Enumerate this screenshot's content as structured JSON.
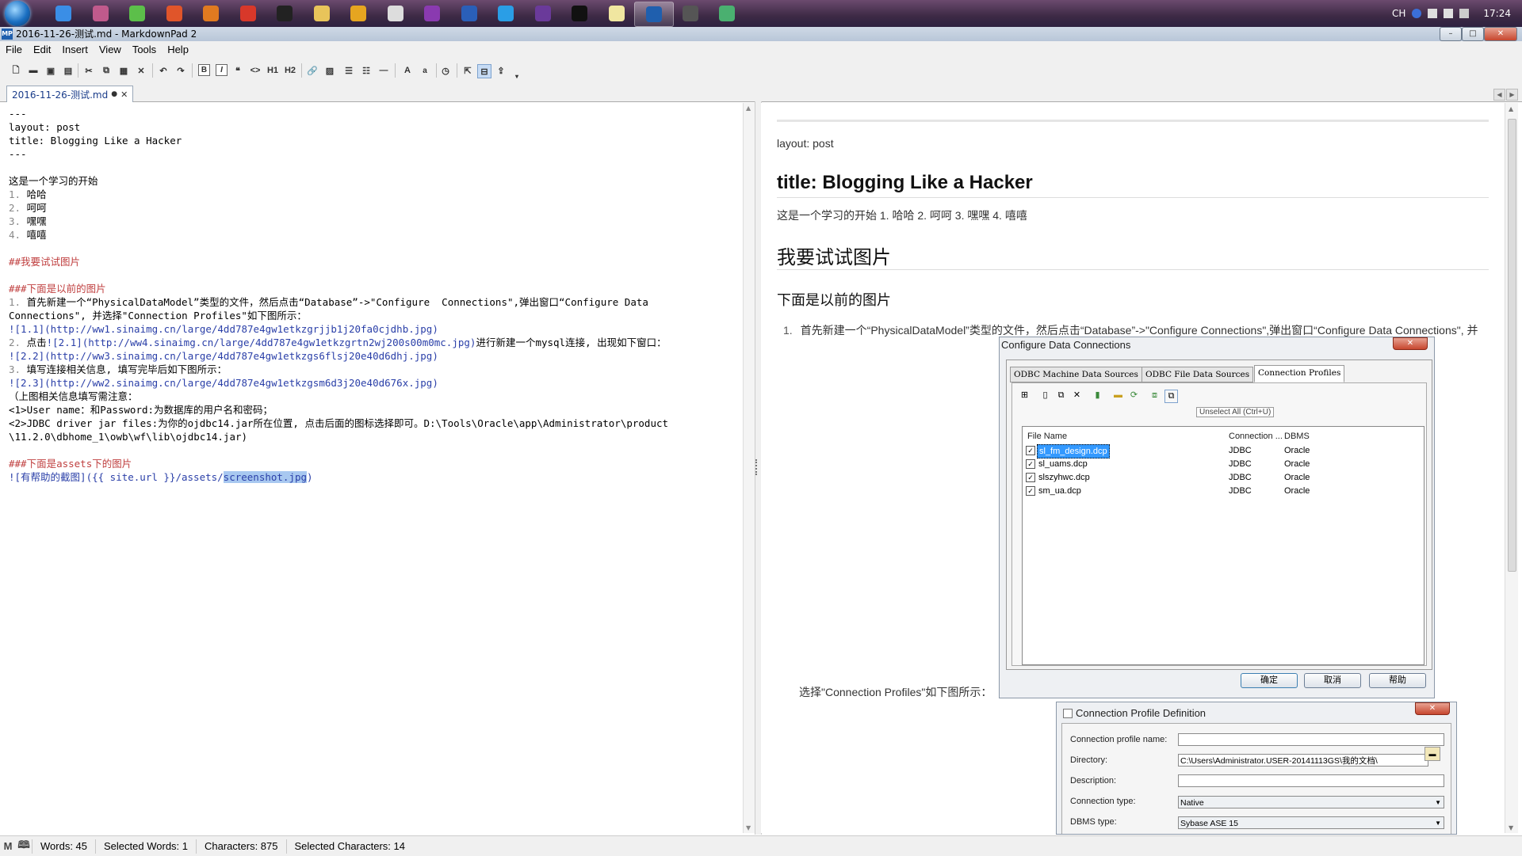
{
  "taskbar": {
    "apps": [
      {
        "name": "ie-icon",
        "color": "#3a8ee6"
      },
      {
        "name": "flower-app-icon",
        "color": "#c05a8c"
      },
      {
        "name": "green-app-icon",
        "color": "#5cbf4a"
      },
      {
        "name": "h-app-icon",
        "color": "#e0552a"
      },
      {
        "name": "firefox-icon",
        "color": "#e07a20"
      },
      {
        "name": "weibo-icon",
        "color": "#d8382a"
      },
      {
        "name": "chrome-dark-icon",
        "color": "#222222"
      },
      {
        "name": "folder-icon",
        "color": "#e8c45a"
      },
      {
        "name": "chrome-icon",
        "color": "#e6a520"
      },
      {
        "name": "circle-app-icon",
        "color": "#dddddd"
      },
      {
        "name": "onenote-icon",
        "color": "#8a3ab0"
      },
      {
        "name": "task-app-icon",
        "color": "#2a5fb8"
      },
      {
        "name": "qq-browser-icon",
        "color": "#2a9ee6"
      },
      {
        "name": "n-app-icon",
        "color": "#6a3a9a"
      },
      {
        "name": "cmd-icon",
        "color": "#111111"
      },
      {
        "name": "notepad-icon",
        "color": "#f0e6a0"
      },
      {
        "name": "markdownpad-icon",
        "color": "#1f5fae"
      },
      {
        "name": "m-app-icon",
        "color": "#555555"
      },
      {
        "name": "m-green-app-icon",
        "color": "#4ab070"
      }
    ],
    "tray": {
      "lang": "CH",
      "time": "17:24"
    }
  },
  "window": {
    "app_icon_text": "MP",
    "title": "2016-11-26-测试.md - MarkdownPad 2",
    "min": "–",
    "max": "□",
    "close": "✕"
  },
  "menu": [
    "File",
    "Edit",
    "Insert",
    "View",
    "Tools",
    "Help"
  ],
  "toolbar": {
    "h1": "H1",
    "h2": "H2",
    "bold": "B",
    "italic": "I",
    "font_big": "A",
    "font_small": "a"
  },
  "tab": {
    "label": "2016-11-26-测试.md",
    "modified": "●",
    "close": "✕"
  },
  "editor": {
    "lines": [
      [
        {
          "t": "---"
        }
      ],
      [
        {
          "t": "layout: post"
        }
      ],
      [
        {
          "t": "title: Blogging Like a Hacker"
        }
      ],
      [
        {
          "t": "---"
        }
      ],
      [
        {
          "t": ""
        }
      ],
      [
        {
          "t": "这是一个学习的开始"
        }
      ],
      [
        {
          "t": "1. ",
          "c": "c-num"
        },
        {
          "t": "哈哈"
        }
      ],
      [
        {
          "t": "2. ",
          "c": "c-num"
        },
        {
          "t": "呵呵"
        }
      ],
      [
        {
          "t": "3. ",
          "c": "c-num"
        },
        {
          "t": "嘿嘿"
        }
      ],
      [
        {
          "t": "4. ",
          "c": "c-num"
        },
        {
          "t": "嘻嘻"
        }
      ],
      [
        {
          "t": ""
        }
      ],
      [
        {
          "t": "##我要试试图片",
          "c": "c-head"
        }
      ],
      [
        {
          "t": ""
        }
      ],
      [
        {
          "t": "###下面是以前的图片",
          "c": "c-head"
        }
      ],
      [
        {
          "t": "1. ",
          "c": "c-num"
        },
        {
          "t": "首先新建一个“PhysicalDataModel”类型的文件，然后点击“Database”->\"Configure  Connections\",弹出窗口“Configure Data"
        }
      ],
      [
        {
          "t": "Connections\", 并选择\"Connection Profiles\"如下图所示："
        }
      ],
      [
        {
          "t": "![1.1](http://ww1.sinaimg.cn/large/4dd787e4gw1etkzgrjjb1j20fa0cjdhb.jpg)",
          "c": "c-link"
        }
      ],
      [
        {
          "t": "2. ",
          "c": "c-num"
        },
        {
          "t": "点击"
        },
        {
          "t": "![2.1](http://ww4.sinaimg.cn/large/4dd787e4gw1etkzgrtn2wj200s00m0mc.jpg)",
          "c": "c-link"
        },
        {
          "t": "进行新建一个mysql连接, 出现如下窗口："
        }
      ],
      [
        {
          "t": "![2.2](http://ww3.sinaimg.cn/large/4dd787e4gw1etkzgs6flsj20e40d6dhj.jpg)",
          "c": "c-link"
        }
      ],
      [
        {
          "t": "3. ",
          "c": "c-num"
        },
        {
          "t": "填写连接相关信息, 填写完毕后如下图所示："
        }
      ],
      [
        {
          "t": "![2.3](http://ww2.sinaimg.cn/large/4dd787e4gw1etkzgsm6d3j20e40d676x.jpg)",
          "c": "c-link"
        }
      ],
      [
        {
          "t": "（上图相关信息填写需注意："
        }
      ],
      [
        {
          "t": "<1>User name：和Password:为数据库的用户名和密码；"
        }
      ],
      [
        {
          "t": "<2>JDBC driver jar files:为你的ojdbc14.jar所在位置, 点击后面的图标选择即可。D:\\Tools\\Oracle\\app\\Administrator\\product"
        }
      ],
      [
        {
          "t": "\\11.2.0\\dbhome_1\\owb\\wf\\lib\\ojdbc14.jar)"
        }
      ],
      [
        {
          "t": ""
        }
      ],
      [
        {
          "t": "###下面是assets下的图片",
          "c": "c-head"
        }
      ],
      [
        {
          "t": "![有帮助的截图]({{ site.url }}/assets/",
          "c": "c-link"
        },
        {
          "t": "screenshot.jpg",
          "c": "c-sel"
        },
        {
          "t": ")",
          "c": "c-link"
        }
      ]
    ]
  },
  "preview": {
    "layout": "layout: post",
    "title": "title: Blogging Like a Hacker",
    "intro": "这是一个学习的开始 1. 哈哈 2. 呵呵 3. 嘿嘿 4. 嘻嘻",
    "h2": "我要试试图片",
    "h3": "下面是以前的图片",
    "li1_num": "1.",
    "li1": "首先新建一个“PhysicalDataModel”类型的文件，然后点击“Database”->\"Configure Connections\",弹出窗口“Configure Data Connections\", 并",
    "select_text": "选择\"Connection Profiles\"如下图所示："
  },
  "dialog1": {
    "title": "Configure Data Connections",
    "tabs": [
      "ODBC Machine Data Sources",
      "ODBC File Data Sources",
      "Connection Profiles"
    ],
    "tooltip": "Unselect All (Ctrl+U)",
    "headers": {
      "file": "File Name",
      "conn": "Connection ...",
      "dbms": "DBMS"
    },
    "rows": [
      {
        "file": "sl_fm_design.dcp",
        "conn": "JDBC",
        "dbms": "Oracle",
        "check": "✓"
      },
      {
        "file": "sl_uams.dcp",
        "conn": "JDBC",
        "dbms": "Oracle",
        "check": "✓"
      },
      {
        "file": "slszyhwc.dcp",
        "conn": "JDBC",
        "dbms": "Oracle",
        "check": "✓"
      },
      {
        "file": "sm_ua.dcp",
        "conn": "JDBC",
        "dbms": "Oracle",
        "check": "✓"
      }
    ],
    "buttons": {
      "ok": "确定",
      "cancel": "取消",
      "help": "帮助"
    }
  },
  "dialog2": {
    "title": "Connection Profile Definition",
    "fields": {
      "name_label": "Connection profile name:",
      "name_value": "",
      "dir_label": "Directory:",
      "dir_value": "C:\\Users\\Administrator.USER-20141113GS\\我的文档\\",
      "desc_label": "Description:",
      "desc_value": "",
      "type_label": "Connection type:",
      "type_value": "Native",
      "dbms_label": "DBMS type:",
      "dbms_value": "Sybase ASE 15"
    }
  },
  "status": {
    "words": "Words: 45",
    "sel_words": "Selected Words: 1",
    "chars": "Characters: 875",
    "sel_chars": "Selected Characters: 14"
  }
}
